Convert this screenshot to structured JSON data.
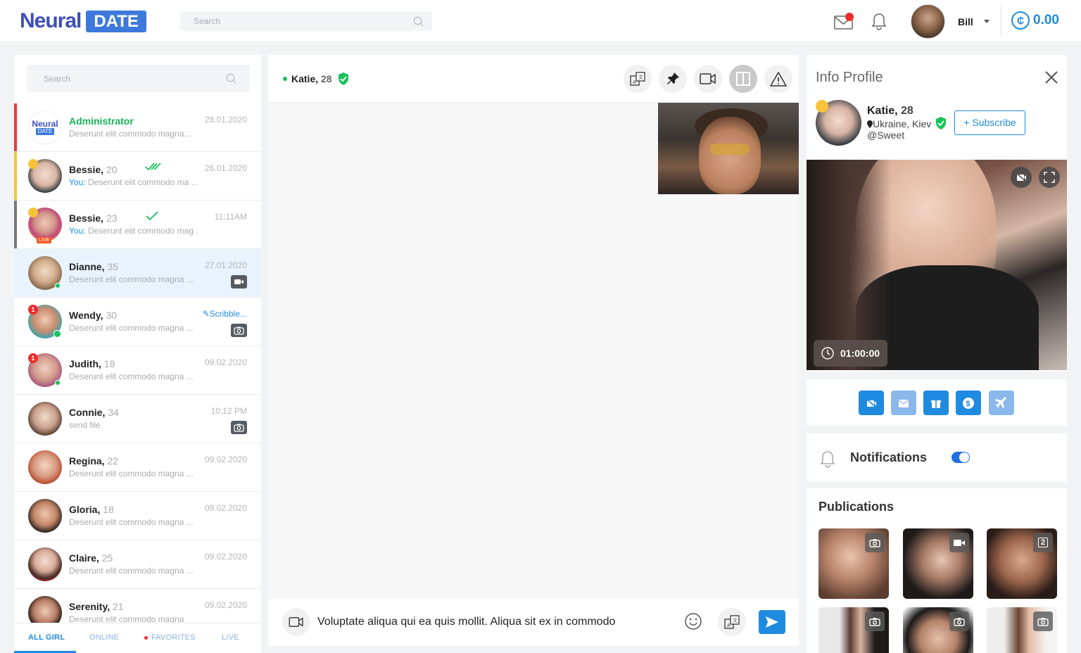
{
  "header": {
    "logo_neural": "Neural",
    "logo_date": "DATE",
    "search_placeholder": "Search",
    "user_name": "Bill",
    "credits": "0.00",
    "credit_symbol": "₵"
  },
  "sidebar": {
    "search_placeholder": "Search",
    "rows": [
      {
        "name": "Administrator",
        "age": "",
        "msg": "Deserunt elit commodo magna...",
        "you": "",
        "date": "28.01.2020",
        "bar": "#ee3b3b"
      },
      {
        "name": "Bessie,",
        "age": "20",
        "msg": "Deserunt elit commodo ma ...",
        "you": "You:",
        "date": "26.01.2020",
        "bar": "#f8c33c"
      },
      {
        "name": "Bessie,",
        "age": "23",
        "msg": "Deserunt elit commodo mag ...",
        "you": "You:",
        "date": "11:11AM",
        "bar": "#777777",
        "live": "LIVE"
      },
      {
        "name": "Dianne,",
        "age": "35",
        "msg": "Deserunt elit commodo magna ...",
        "you": "",
        "date": "27.01.2020"
      },
      {
        "name": "Wendy,",
        "age": "30",
        "msg": "Deserunt elit commodo magna ...",
        "you": "",
        "date": "Scribble...",
        "count": "1"
      },
      {
        "name": "Judith,",
        "age": "18",
        "msg": "Deserunt elit commodo magna ...",
        "you": "",
        "date": "09.02.2020",
        "count": "1"
      },
      {
        "name": "Connie,",
        "age": "34",
        "msg": "send file",
        "you": "",
        "date": "10:12 PM"
      },
      {
        "name": "Regina,",
        "age": "22",
        "msg": "Deserunt elit commodo magna ...",
        "you": "",
        "date": "09.02.2020"
      },
      {
        "name": "Gloria,",
        "age": "18",
        "msg": "Deserunt elit commodo magna ...",
        "you": "",
        "date": "09.02.2020"
      },
      {
        "name": "Claire,",
        "age": "25",
        "msg": "Deserunt elit commodo magna ...",
        "you": "",
        "date": "09.02.2020"
      },
      {
        "name": "Serenity,",
        "age": "21",
        "msg": "Deserunt elit commodo magna",
        "you": "",
        "date": "09.02.2020"
      }
    ],
    "tabs": [
      "ALL GIRL",
      "ONLINE",
      "FAVORITES",
      "LIVE"
    ]
  },
  "chat": {
    "name": "Katie,",
    "age": "28",
    "composer_text": "Voluptate aliqua qui ea quis mollit. Aliqua sit ex in commodo"
  },
  "profile": {
    "title": "Info Profile",
    "name": "Katie,",
    "age": "28",
    "location": "Ukraine, Kiev",
    "handle": "@Sweet",
    "subscribe": "+ Subscribe",
    "timer": "01:00:00",
    "notifications_label": "Notifications",
    "notifications_on": true,
    "publications_title": "Publications",
    "pub_badge": "2"
  },
  "colors": {
    "accent": "#1f8be0",
    "online": "#17c25a",
    "admin": "#17b35a",
    "alert": "#ee2b2b"
  }
}
